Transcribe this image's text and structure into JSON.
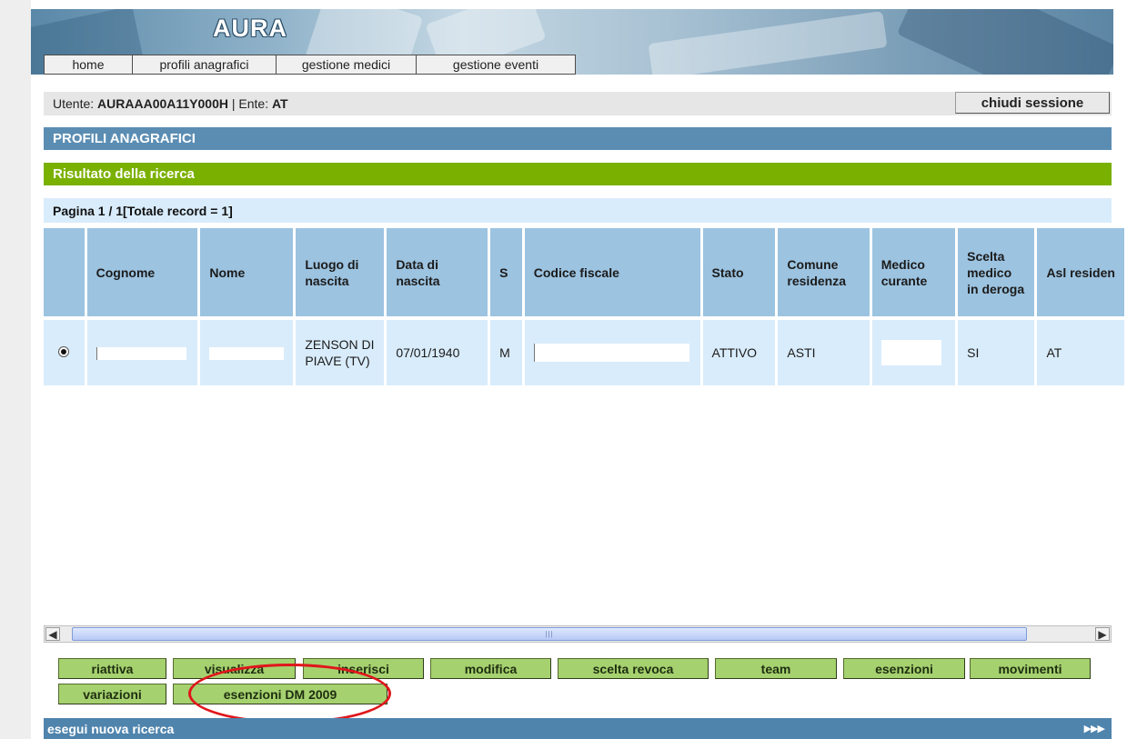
{
  "app": {
    "logo": "AURA"
  },
  "nav": {
    "tabs": [
      {
        "label": "home"
      },
      {
        "label": "profili anagrafici"
      },
      {
        "label": "gestione medici"
      },
      {
        "label": "gestione eventi"
      }
    ]
  },
  "session": {
    "user_prefix": "Utente: ",
    "user_id": "AURAAA00A11Y000H",
    "ente_prefix": " | Ente: ",
    "ente": "AT",
    "logout_label": "chiudi sessione"
  },
  "page": {
    "title": "PROFILI ANAGRAFICI",
    "subtitle": "Risultato della ricerca",
    "pager_prefix": "Pagina ",
    "pager_value": "1 / 1",
    "pager_suffix": " [Totale record = 1]"
  },
  "table": {
    "headers": {
      "cognome": "Cognome",
      "nome": "Nome",
      "luogo": "Luogo di nascita",
      "data": "Data di nascita",
      "sesso": "S",
      "cf": "Codice fiscale",
      "stato": "Stato",
      "comune": "Comune residenza",
      "medico": "Medico curante",
      "scelta": "Scelta medico in deroga",
      "asl": "Asl residen"
    },
    "rows": [
      {
        "selected": true,
        "cognome": "[redacted]",
        "nome": "[redacted]",
        "luogo": "ZENSON DI PIAVE (TV)",
        "data": "07/01/1940",
        "sesso": "M",
        "cf": "[redacted]",
        "stato": "ATTIVO",
        "comune": "ASTI",
        "medico": "[redacted]",
        "scelta": "SI",
        "asl": "AT"
      }
    ]
  },
  "actions": {
    "riattiva": "riattiva",
    "visualizza": "visualizza",
    "inserisci": "inserisci",
    "modifica": "modifica",
    "scelta_revoca": "scelta revoca",
    "team": "team",
    "esenzioni": "esenzioni",
    "movimenti": "movimenti",
    "variazioni": "variazioni",
    "esenzioni_dm": "esenzioni DM 2009"
  },
  "footer": {
    "new_search": "esegui nuova ricerca",
    "more": "▶▶▶"
  },
  "colors": {
    "section_blue": "#5b8db3",
    "result_green": "#7ab000",
    "header_cell": "#9cc3e0",
    "row_cell": "#d9ecfb",
    "action_green": "#a5d16f",
    "annotation_red": "#e0161b"
  }
}
